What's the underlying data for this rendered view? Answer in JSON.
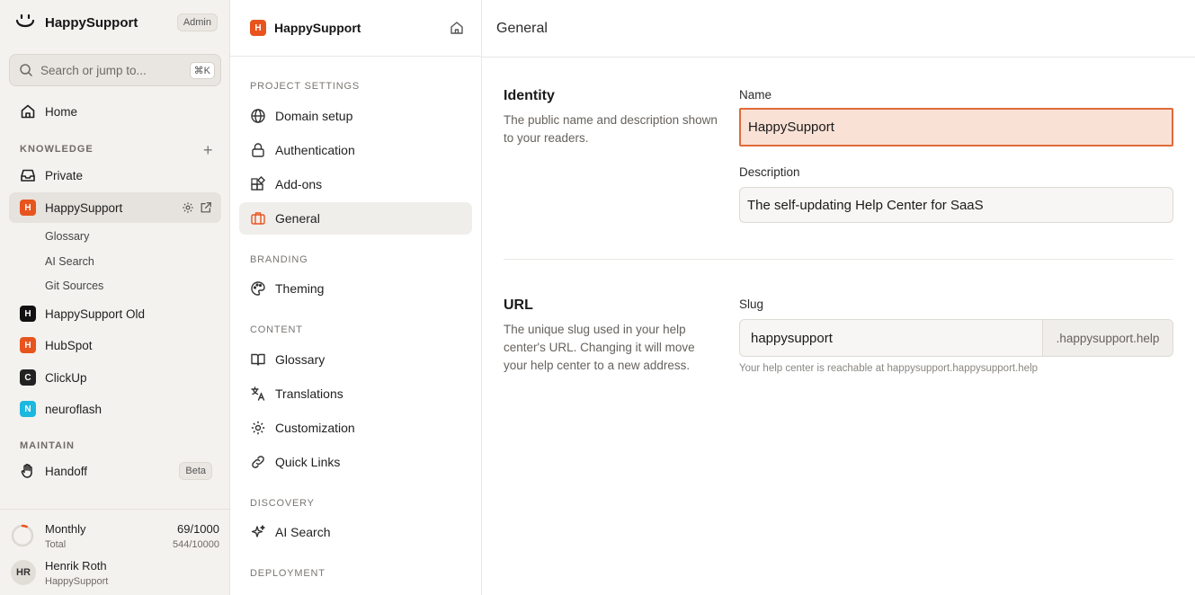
{
  "app": {
    "name": "HappySupport",
    "role_badge": "Admin"
  },
  "search": {
    "placeholder": "Search or jump to...",
    "shortcut": "⌘K"
  },
  "sidebar": {
    "home_label": "Home",
    "knowledge_label": "KNOWLEDGE",
    "private_label": "Private",
    "projects": [
      {
        "initial": "H",
        "name": "HappySupport",
        "color": "#e8541e"
      },
      {
        "initial": "H",
        "name": "HappySupport Old",
        "color": "#111111"
      },
      {
        "initial": "H",
        "name": "HubSpot",
        "color": "#e8541e"
      },
      {
        "initial": "C",
        "name": "ClickUp",
        "color": "#222222"
      },
      {
        "initial": "N",
        "name": "neuroflash",
        "color": "#1cb8e0"
      }
    ],
    "sub_items": [
      "Glossary",
      "AI Search",
      "Git Sources"
    ],
    "maintain_label": "MAINTAIN",
    "handoff_label": "Handoff",
    "beta_badge": "Beta"
  },
  "usage": {
    "title": "Monthly",
    "subtitle": "Total",
    "value": "69/1000",
    "total": "544/10000",
    "fraction": 0.069
  },
  "user": {
    "initials": "HR",
    "name": "Henrik Roth",
    "org": "HappySupport"
  },
  "settings_nav": {
    "title": "HappySupport",
    "badge_initial": "H",
    "sections": {
      "project_settings": "PROJECT SETTINGS",
      "branding": "BRANDING",
      "content": "CONTENT",
      "discovery": "DISCOVERY",
      "deployment": "DEPLOYMENT"
    },
    "items": {
      "domain_setup": "Domain setup",
      "authentication": "Authentication",
      "add_ons": "Add-ons",
      "general": "General",
      "theming": "Theming",
      "glossary": "Glossary",
      "translations": "Translations",
      "customization": "Customization",
      "quick_links": "Quick Links",
      "ai_search": "AI Search"
    }
  },
  "main": {
    "title": "General",
    "identity": {
      "title": "Identity",
      "description": "The public name and description shown to your readers.",
      "name_label": "Name",
      "name_value": "HappySupport",
      "description_label": "Description",
      "description_value": "The self-updating Help Center for SaaS"
    },
    "url": {
      "title": "URL",
      "description": "The unique slug used in your help center's URL. Changing it will move your help center to a new address.",
      "slug_label": "Slug",
      "slug_value": "happysupport",
      "slug_suffix": ".happysupport.help",
      "hint": "Your help center is reachable at happysupport.happysupport.help"
    }
  },
  "colors": {
    "accent": "#e8541e",
    "focus_bg": "#f9e1d6"
  }
}
